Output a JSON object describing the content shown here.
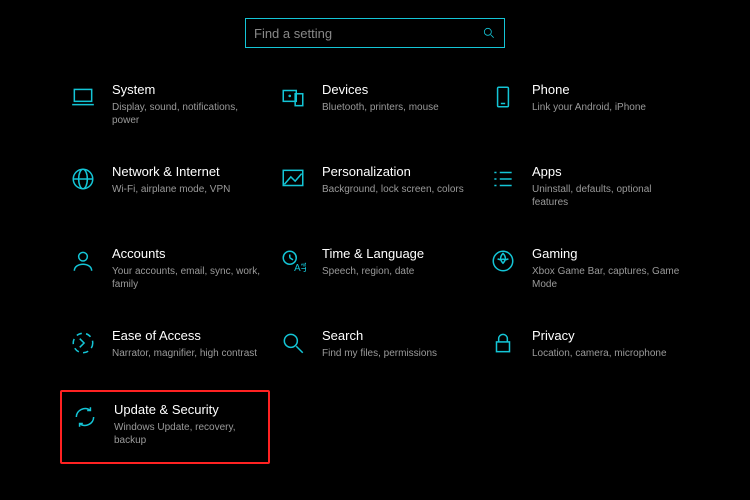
{
  "search": {
    "placeholder": "Find a setting"
  },
  "tiles": {
    "system": {
      "title": "System",
      "desc": "Display, sound, notifications, power"
    },
    "devices": {
      "title": "Devices",
      "desc": "Bluetooth, printers, mouse"
    },
    "phone": {
      "title": "Phone",
      "desc": "Link your Android, iPhone"
    },
    "network": {
      "title": "Network & Internet",
      "desc": "Wi-Fi, airplane mode, VPN"
    },
    "personalization": {
      "title": "Personalization",
      "desc": "Background, lock screen, colors"
    },
    "apps": {
      "title": "Apps",
      "desc": "Uninstall, defaults, optional features"
    },
    "accounts": {
      "title": "Accounts",
      "desc": "Your accounts, email, sync, work, family"
    },
    "time": {
      "title": "Time & Language",
      "desc": "Speech, region, date"
    },
    "gaming": {
      "title": "Gaming",
      "desc": "Xbox Game Bar, captures, Game Mode"
    },
    "ease": {
      "title": "Ease of Access",
      "desc": "Narrator, magnifier, high contrast"
    },
    "search_cat": {
      "title": "Search",
      "desc": "Find my files, permissions"
    },
    "privacy": {
      "title": "Privacy",
      "desc": "Location, camera, microphone"
    },
    "update": {
      "title": "Update & Security",
      "desc": "Windows Update, recovery, backup"
    }
  }
}
